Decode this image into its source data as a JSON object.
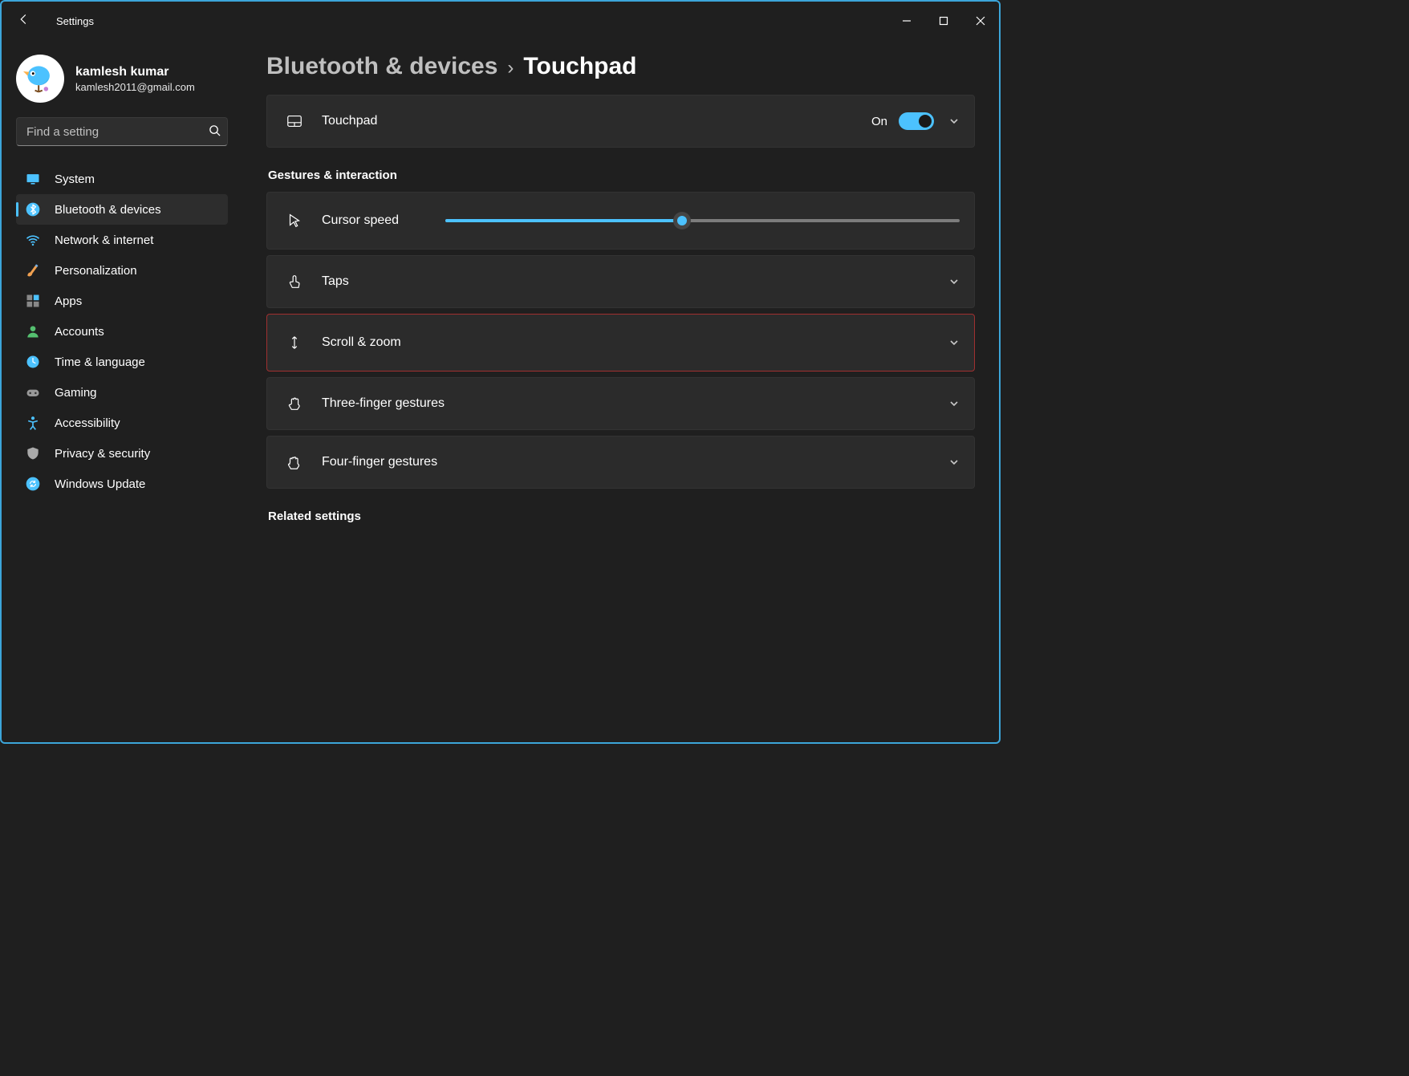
{
  "window": {
    "app_title": "Settings"
  },
  "profile": {
    "name": "kamlesh kumar",
    "email": "kamlesh2011@gmail.com"
  },
  "search": {
    "placeholder": "Find a setting"
  },
  "sidebar": {
    "items": [
      {
        "label": "System"
      },
      {
        "label": "Bluetooth & devices"
      },
      {
        "label": "Network & internet"
      },
      {
        "label": "Personalization"
      },
      {
        "label": "Apps"
      },
      {
        "label": "Accounts"
      },
      {
        "label": "Time & language"
      },
      {
        "label": "Gaming"
      },
      {
        "label": "Accessibility"
      },
      {
        "label": "Privacy & security"
      },
      {
        "label": "Windows Update"
      }
    ],
    "selected_index": 1
  },
  "breadcrumb": {
    "parent": "Bluetooth & devices",
    "current": "Touchpad"
  },
  "touchpad": {
    "label": "Touchpad",
    "state_label": "On",
    "enabled": true
  },
  "sections": {
    "gestures_header": "Gestures & interaction",
    "cursor_speed": {
      "label": "Cursor speed",
      "value_percent": 46
    },
    "taps": {
      "label": "Taps"
    },
    "scroll_zoom": {
      "label": "Scroll & zoom"
    },
    "three_finger": {
      "label": "Three-finger gestures"
    },
    "four_finger": {
      "label": "Four-finger gestures"
    },
    "related_header": "Related settings"
  },
  "colors": {
    "accent": "#4cc2ff"
  }
}
